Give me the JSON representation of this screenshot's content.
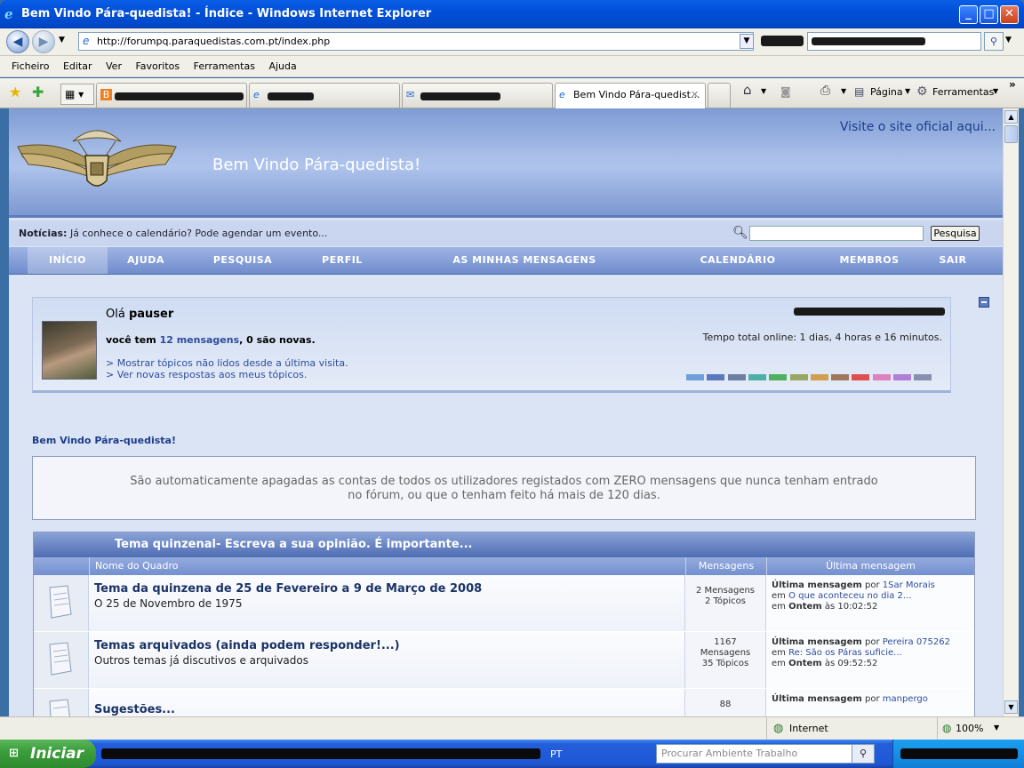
{
  "window": {
    "title": "Bem Vindo Pára-quedista! - Índice - Windows Internet Explorer"
  },
  "address_bar": {
    "url": "http://forumpq.paraquedistas.com.pt/index.php"
  },
  "menu": [
    "Ficheiro",
    "Editar",
    "Ver",
    "Favoritos",
    "Ferramentas",
    "Ajuda"
  ],
  "tabs": {
    "active_label": "Bem Vindo Pára-quedist..."
  },
  "toolbar": {
    "page_label": "Página",
    "tools_label": "Ferramentas"
  },
  "site": {
    "visit_link": "Visite o site oficial aqui...",
    "title": "Bem Vindo Pára-quedista!",
    "news_label": "Notícias:",
    "news_text": "Já conhece o calendário? Pode agendar um evento...",
    "search_button": "Pesquisa"
  },
  "nav": [
    "INÍCIO",
    "AJUDA",
    "PESQUISA",
    "PERFIL",
    "AS MINHAS MENSAGENS",
    "CALENDÁRIO",
    "MEMBROS",
    "SAIR"
  ],
  "welcome": {
    "greeting": "Olá",
    "username": "pauser",
    "msg_prefix": "você tem",
    "msg_link": "12 mensagens",
    "msg_suffix": ", 0 são novas.",
    "online_time": "Tempo total online: 1 dias, 4 horas e 16 minutos.",
    "link1": "Mostrar tópicos não lidos desde a última visita.",
    "link2": "Ver novas respostas aos meus tópicos.",
    "swatches": [
      "#6f9fd8",
      "#5a78c0",
      "#6c7fa0",
      "#4ab0a8",
      "#4fb060",
      "#98a860",
      "#d0a050",
      "#a07860",
      "#e05050",
      "#e080c0",
      "#b080d8",
      "#8890b0"
    ]
  },
  "board_title": "Bem Vindo Pára-quedista!",
  "notice": {
    "line1": "São automaticamente apagadas as contas de todos os utilizadores registados com ZERO mensagens que nunca tenham entrado",
    "line2": "no fórum, ou que o tenham feito há mais de 120 dias."
  },
  "category": {
    "title": "Tema quinzenal- Escreva a sua opinião. É importante...",
    "col_board": "Nome do Quadro",
    "col_posts": "Mensagens",
    "col_last": "Última mensagem"
  },
  "boards": [
    {
      "title": "Tema da quinzena de 25 de Fevereiro a 9 de Março de 2008",
      "desc": "O 25 de Novembro de 1975",
      "posts_line1": "2 Mensagens",
      "posts_line2": "2 Tópicos",
      "last_label": "Última mensagem",
      "by": "por",
      "author": "1Sar Morais",
      "in": "em",
      "topic": "O que aconteceu no dia 2...",
      "when_in": "em",
      "day": "Ontem",
      "at": "às 10:02:52"
    },
    {
      "title": "Temas arquivados (ainda podem responder!...)",
      "desc": "Outros temas já discutivos e arquivados",
      "posts_line1": "1167",
      "posts_line2": "Mensagens",
      "posts_line3": "35 Tópicos",
      "last_label": "Última mensagem",
      "by": "por",
      "author": "Pereira 075262",
      "in": "em",
      "topic": "Re: São os Páras suficie...",
      "when_in": "em",
      "day": "Ontem",
      "at": "às 09:52:52"
    },
    {
      "title": "Sugestões...",
      "desc": "",
      "posts_line1": "88",
      "posts_line2": "",
      "last_label": "Última mensagem",
      "by": "por",
      "author": "manpergo"
    }
  ],
  "statusbar": {
    "zone": "Internet",
    "zoom": "100%"
  },
  "taskbar": {
    "start": "Iniciar",
    "lang": "PT",
    "search_placeholder": "Procurar Ambiente Trabalho"
  }
}
